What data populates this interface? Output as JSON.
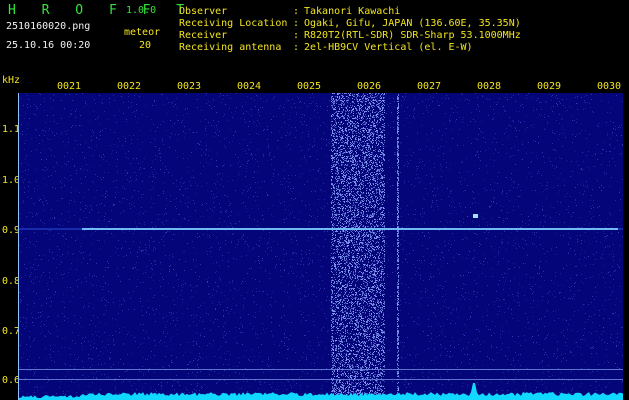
{
  "header": {
    "app_title": "H R O F F T",
    "version": "1.0.0",
    "file_name": "2510160020.png",
    "meteor_label": "meteor",
    "datetime": "25.10.16 00:20",
    "meteor_count": "20",
    "info": [
      {
        "key": "Observer",
        "value": "Takanori Kawachi"
      },
      {
        "key": "Receiving Location",
        "value": "Ogaki, Gifu, JAPAN (136.60E, 35.35N)"
      },
      {
        "key": "Receiver",
        "value": "R820T2(RTL-SDR) SDR-Sharp 53.1000MHz"
      },
      {
        "key": "Receiving antenna",
        "value": "2el-HB9CV Vertical (el. E-W)"
      }
    ]
  },
  "spectrogram": {
    "unit_label": "kHz",
    "time_ticks": [
      "0021",
      "0022",
      "0023",
      "0024",
      "0025",
      "0026",
      "0027",
      "0028",
      "0029",
      "0030"
    ],
    "freq_ticks": [
      "1.1",
      "1.0",
      "0.9",
      "0.8",
      "0.7",
      "0.6"
    ],
    "colors": {
      "background": "#05057a",
      "noise": "#3a4bd0",
      "signal": "#7fd4ff",
      "floor": "#10d8ff",
      "labels": "#f2e51f",
      "title": "#36e23a"
    }
  }
}
